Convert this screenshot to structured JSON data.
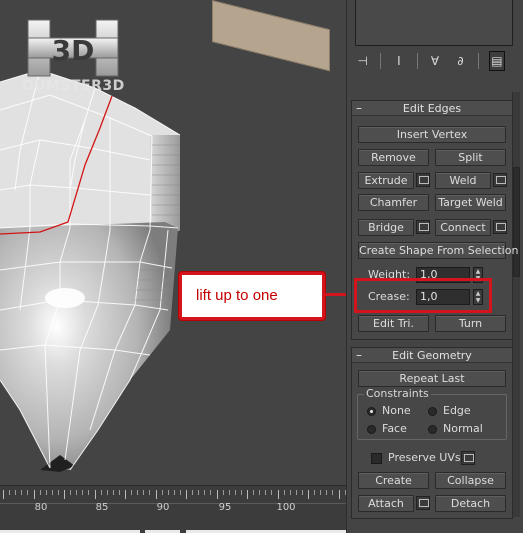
{
  "watermark": {
    "badge": "3D",
    "text": "DUMSTER3D"
  },
  "annotation": {
    "text": "lift up to one"
  },
  "timeline": {
    "numbers": [
      "80",
      "85",
      "90",
      "95",
      "100"
    ]
  },
  "edit_edges": {
    "title": "Edit Edges",
    "insert_vertex": "Insert Vertex",
    "remove": "Remove",
    "split": "Split",
    "extrude": "Extrude",
    "weld": "Weld",
    "chamfer": "Chamfer",
    "target_weld": "Target Weld",
    "bridge": "Bridge",
    "connect": "Connect",
    "create_shape": "Create Shape From Selection",
    "weight_label": "Weight:",
    "weight_value": "1,0",
    "crease_label": "Crease:",
    "crease_value": "1,0",
    "edit_tri": "Edit Tri.",
    "turn": "Turn"
  },
  "edit_geometry": {
    "title": "Edit Geometry",
    "repeat_last": "Repeat Last",
    "constraints_label": "Constraints",
    "none": "None",
    "edge": "Edge",
    "face": "Face",
    "normal": "Normal",
    "preserve_uvs": "Preserve UVs",
    "create": "Create",
    "collapse": "Collapse",
    "attach": "Attach",
    "detach": "Detach",
    "selected_constraint": "None"
  },
  "toolbar_icons": [
    "pin-stack-icon",
    "modifier-icon",
    "show-end-result-icon",
    "make-unique-icon",
    "configure-sets-icon"
  ]
}
